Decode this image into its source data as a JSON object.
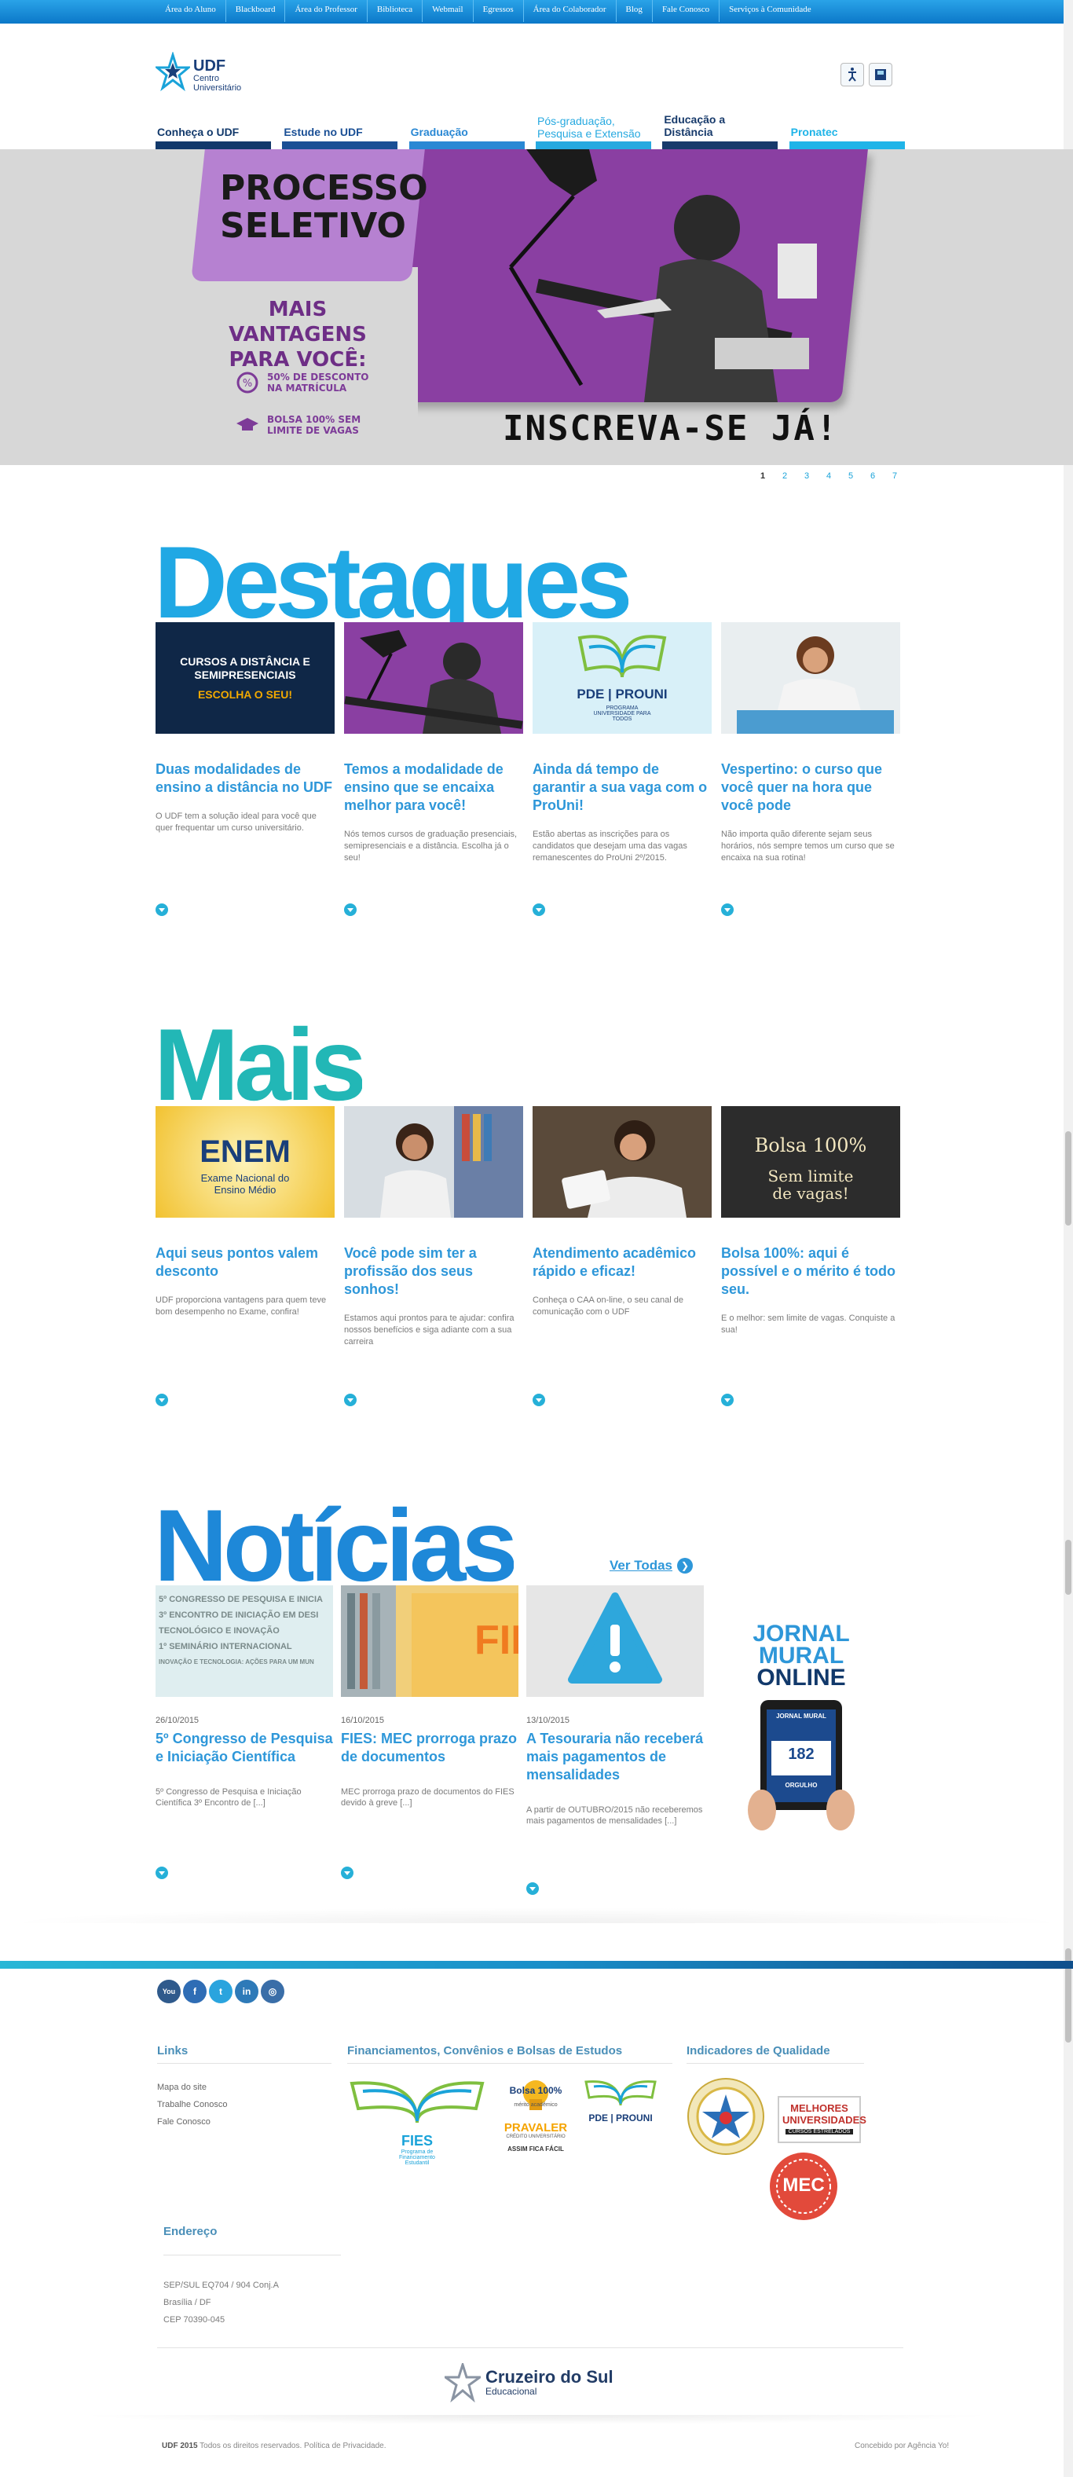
{
  "colors": {
    "brand_blue": "#2e97d9",
    "nav_dark": "#12396b",
    "topbar": "#1a8fd8",
    "banner_purple": "#8a3fa2"
  },
  "topbar": {
    "links": [
      "Área do Aluno",
      "Blackboard",
      "Área do Professor",
      "Biblioteca",
      "Webmail",
      "Egressos",
      "Área do Colaborador",
      "Blog",
      "Fale Conosco",
      "Serviços à Comunidade"
    ]
  },
  "header": {
    "logo_name": "UDF",
    "logo_sub1": "Centro",
    "logo_sub2": "Universitário",
    "icons": [
      "accessibility-icon",
      "contrast-icon"
    ]
  },
  "nav": {
    "items": [
      {
        "label": "Conheça o UDF",
        "color": "#12396b"
      },
      {
        "label": "Estude no UDF",
        "color": "#1a4f95"
      },
      {
        "label": "Graduação",
        "color": "#2a88d4"
      },
      {
        "label": "Pós-graduação, Pesquisa e Extensão",
        "color": "#26a9e0"
      },
      {
        "label": "Educação a Distância",
        "color": "#173a6b"
      },
      {
        "label": "Pronatec",
        "color": "#1fb4e8"
      }
    ]
  },
  "banner": {
    "title_line1": "PROCESSO",
    "title_line2": "SELETIVO",
    "vantagens": "MAIS VANTAGENS PARA VOCÊ:",
    "item1": "50% DE DESCONTO NA MATRÍCULA",
    "item2": "BOLSA 100% SEM LIMITE DE VAGAS",
    "cta": "INSCREVA-SE JÁ!",
    "pages": [
      "1",
      "2",
      "3",
      "4",
      "5",
      "6",
      "7"
    ],
    "active_page": "1"
  },
  "destaques": {
    "heading": "Destaques",
    "cards": [
      {
        "image_text": "CURSOS A DISTÂNCIA E SEMIPRESENCIAIS",
        "image_accent": "ESCOLHA O SEU!",
        "title": "Duas modalidades de ensino a distância no UDF",
        "desc": "O UDF tem a solução ideal para você que quer frequentar um curso universitário."
      },
      {
        "image_text": "",
        "image_accent": "",
        "title": "Temos a modalidade de ensino que se encaixa melhor para você!",
        "desc": "Nós temos cursos de graduação presenciais, semipresenciais e a distância. Escolha já o seu!"
      },
      {
        "image_text": "PDE | PROUNI",
        "image_accent": "PROGRAMA UNIVERSIDADE PARA TODOS",
        "title": "Ainda dá tempo de garantir a sua vaga com o ProUni!",
        "desc": "Estão abertas as inscrições para os candidatos que desejam uma das vagas remanescentes do ProUni 2º/2015."
      },
      {
        "image_text": "",
        "image_accent": "",
        "title": "Vespertino: o curso que você quer na hora que você pode",
        "desc": "Não importa quão diferente sejam seus horários, nós sempre temos um curso que se encaixa na sua rotina!"
      }
    ]
  },
  "mais": {
    "heading": "Mais",
    "cards": [
      {
        "image_text": "ENEM",
        "image_accent": "Exame Nacional do Ensino Médio",
        "title": "Aqui seus pontos valem desconto",
        "desc": "UDF proporciona vantagens para quem teve bom desempenho no Exame, confira!"
      },
      {
        "image_text": "",
        "image_accent": "",
        "title": "Você pode sim ter a profissão dos seus sonhos!",
        "desc": "Estamos aqui prontos para te ajudar: confira nossos benefícios e siga adiante com a sua carreira"
      },
      {
        "image_text": "",
        "image_accent": "",
        "title": "Atendimento acadêmico rápido e eficaz!",
        "desc": "Conheça o CAA on-line, o seu canal de comunicação com o UDF"
      },
      {
        "image_text": "Bolsa 100%",
        "image_accent": "Sem limite de vagas!",
        "title": "Bolsa 100%: aqui é possível e o mérito é todo seu.",
        "desc": "E o melhor: sem limite de vagas. Conquiste a sua!"
      }
    ]
  },
  "noticias": {
    "heading": "Notícias",
    "ver_todas": "Ver Todas",
    "items": [
      {
        "image_lines": [
          "5º CONGRESSO DE PESQUISA E INICIA",
          "3º ENCONTRO DE INICIAÇÃO EM DESI",
          "TECNOLÓGICO E INOVAÇÃO",
          "1º SEMINÁRIO INTERNACIONAL",
          "INOVAÇÃO E TECNOLOGIA: AÇÕES PARA UM MUN"
        ],
        "date": "26/10/2015",
        "title": "5º Congresso de Pesquisa e Iniciação Científica",
        "desc": "5º Congresso de Pesquisa e Iniciação Científica 3º Encontro de [...]"
      },
      {
        "image_lines": [
          "FIE"
        ],
        "date": "16/10/2015",
        "title": "FIES: MEC prorroga prazo de documentos",
        "desc": "MEC prorroga prazo de documentos do FIES devido à greve [...]"
      },
      {
        "image_lines": [],
        "date": "13/10/2015",
        "title": "A Tesouraria não receberá mais pagamentos de mensalidades",
        "desc": "A partir de OUTUBRO/2015 não receberemos mais pagamentos de mensalidades [...]"
      }
    ],
    "jornal": {
      "line1": "JORNAL",
      "line2": "MURAL",
      "line3": "ONLINE",
      "tablet_label": "JORNAL MURAL",
      "tablet_number": "182",
      "tablet_caption": "ORGULHO"
    }
  },
  "footer": {
    "social": [
      "youtube-icon",
      "facebook-icon",
      "twitter-icon",
      "linkedin-icon",
      "instagram-icon"
    ],
    "social_labels": [
      "You",
      "f",
      "t",
      "in",
      "◎"
    ],
    "links_title": "Links",
    "links": [
      "Mapa do site",
      "Trabalhe Conosco",
      "Fale Conosco"
    ],
    "financ_title": "Financiamentos, Convênios e Bolsas de Estudos",
    "fies_label": "FIES",
    "fies_sub": "Programa de Financiamento Estudantil",
    "bolsa_label": "Bolsa 100%",
    "bolsa_sub": "mérito acadêmico",
    "prouni_label": "PDE | PROUNI",
    "pravaler_label": "PRAVALER",
    "pravaler_sub": "CRÉDITO UNIVERSITÁRIO",
    "pravaler_tag": "ASSIM FICA FÁCIL",
    "indicadores_title": "Indicadores de Qualidade",
    "melhores_label": "MELHORES UNIVERSIDADES",
    "melhores_sub": "CURSOS ESTRELADOS",
    "mec_label": "MEC",
    "endereco_title": "Endereço",
    "endereco_lines": [
      "SEP/SUL EQ704 / 904 Conj.A",
      "Brasília / DF",
      "CEP 70390-045"
    ],
    "cruzeiro1": "Cruzeiro do Sul",
    "cruzeiro2": "Educacional",
    "copyright_brand": "UDF 2015",
    "copyright_text": " Todos os direitos reservados. Política de Privacidade.",
    "agency": "Concebido por Agência Yo!"
  }
}
